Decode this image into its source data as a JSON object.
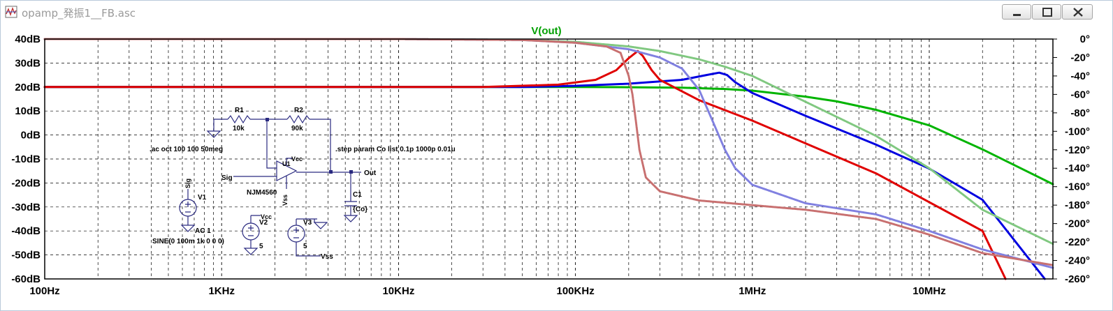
{
  "window": {
    "title": "opamp_発振1__FB.asc",
    "icon": "ltspice-waveform-icon",
    "buttons": [
      "minimize-icon",
      "maximize-icon",
      "close-icon"
    ]
  },
  "chart_data": {
    "type": "line",
    "title": "V(out)",
    "title_color": "#00a000",
    "x_scale": "log",
    "xlim": [
      100,
      50000000
    ],
    "x_ticks": [
      {
        "value": 100,
        "label": "100Hz"
      },
      {
        "value": 1000,
        "label": "1KHz"
      },
      {
        "value": 10000,
        "label": "10KHz"
      },
      {
        "value": 100000,
        "label": "100KHz"
      },
      {
        "value": 1000000,
        "label": "1MHz"
      },
      {
        "value": 10000000,
        "label": "10MHz"
      }
    ],
    "y_left": {
      "unit": "dB",
      "ylim": [
        -60,
        40
      ],
      "ticks": [
        {
          "value": 40,
          "label": "40dB"
        },
        {
          "value": 30,
          "label": "30dB"
        },
        {
          "value": 20,
          "label": "20dB"
        },
        {
          "value": 10,
          "label": "10dB"
        },
        {
          "value": 0,
          "label": "0dB"
        },
        {
          "value": -10,
          "label": "-10dB"
        },
        {
          "value": -20,
          "label": "-20dB"
        },
        {
          "value": -30,
          "label": "-30dB"
        },
        {
          "value": -40,
          "label": "-40dB"
        },
        {
          "value": -50,
          "label": "-50dB"
        },
        {
          "value": -60,
          "label": "-60dB"
        }
      ]
    },
    "y_right": {
      "unit": "°",
      "ylim": [
        -260,
        0
      ],
      "ticks": [
        {
          "value": 0,
          "label": "0°"
        },
        {
          "value": -20,
          "label": "-20°"
        },
        {
          "value": -40,
          "label": "-40°"
        },
        {
          "value": -60,
          "label": "-60°"
        },
        {
          "value": -80,
          "label": "-80°"
        },
        {
          "value": -100,
          "label": "-100°"
        },
        {
          "value": -120,
          "label": "-120°"
        },
        {
          "value": -140,
          "label": "-140°"
        },
        {
          "value": -160,
          "label": "-160°"
        },
        {
          "value": -180,
          "label": "-180°"
        },
        {
          "value": -200,
          "label": "-200°"
        },
        {
          "value": -220,
          "label": "-220°"
        },
        {
          "value": -240,
          "label": "-240°"
        },
        {
          "value": -260,
          "label": "-260°"
        }
      ]
    },
    "grid": true,
    "series": [
      {
        "color": "#00b400",
        "kind": "magnitude",
        "axis": "left",
        "points": [
          [
            100,
            20
          ],
          [
            100000,
            20
          ],
          [
            200000,
            19.9
          ],
          [
            400000,
            19.7
          ],
          [
            700000,
            19.2
          ],
          [
            1000000,
            18.5
          ],
          [
            2000000,
            16
          ],
          [
            3000000,
            14
          ],
          [
            5000000,
            10.5
          ],
          [
            10000000,
            4
          ],
          [
            20000000,
            -6
          ],
          [
            50000000,
            -20.5
          ]
        ]
      },
      {
        "color": "#0000e0",
        "kind": "magnitude",
        "axis": "left",
        "points": [
          [
            100,
            20
          ],
          [
            50000,
            20
          ],
          [
            100000,
            20.5
          ],
          [
            200000,
            21.4
          ],
          [
            400000,
            23
          ],
          [
            550000,
            25
          ],
          [
            650000,
            26
          ],
          [
            720000,
            25
          ],
          [
            800000,
            22
          ],
          [
            1000000,
            17.5
          ],
          [
            2000000,
            8
          ],
          [
            5000000,
            -4
          ],
          [
            10000000,
            -14
          ],
          [
            20000000,
            -27
          ],
          [
            45000000,
            -60
          ]
        ]
      },
      {
        "color": "#e00000",
        "kind": "magnitude",
        "axis": "left",
        "points": [
          [
            100,
            20
          ],
          [
            30000,
            20
          ],
          [
            80000,
            21
          ],
          [
            130000,
            23
          ],
          [
            170000,
            27
          ],
          [
            200000,
            32
          ],
          [
            225000,
            35
          ],
          [
            240000,
            33
          ],
          [
            270000,
            27
          ],
          [
            300000,
            23
          ],
          [
            500000,
            14.5
          ],
          [
            1000000,
            6
          ],
          [
            2000000,
            -3.5
          ],
          [
            5000000,
            -16
          ],
          [
            10000000,
            -28
          ],
          [
            20000000,
            -40
          ],
          [
            27000000,
            -60
          ]
        ]
      },
      {
        "color": "#80c880",
        "kind": "phase",
        "axis": "right",
        "dotted": true,
        "points": [
          [
            100,
            0
          ],
          [
            10000,
            0
          ],
          [
            50000,
            -1
          ],
          [
            100000,
            -3
          ],
          [
            200000,
            -8
          ],
          [
            300000,
            -13
          ],
          [
            500000,
            -22
          ],
          [
            700000,
            -30
          ],
          [
            1000000,
            -40
          ],
          [
            2000000,
            -68
          ],
          [
            5000000,
            -105
          ],
          [
            10000000,
            -140
          ],
          [
            20000000,
            -185
          ],
          [
            50000000,
            -222
          ]
        ]
      },
      {
        "color": "#8080e0",
        "kind": "phase",
        "axis": "right",
        "dotted": true,
        "points": [
          [
            100,
            0
          ],
          [
            10000,
            0
          ],
          [
            50000,
            -1
          ],
          [
            100000,
            -4
          ],
          [
            200000,
            -11
          ],
          [
            300000,
            -20
          ],
          [
            400000,
            -32
          ],
          [
            500000,
            -55
          ],
          [
            600000,
            -90
          ],
          [
            700000,
            -120
          ],
          [
            800000,
            -140
          ],
          [
            1000000,
            -158
          ],
          [
            2000000,
            -178
          ],
          [
            5000000,
            -190
          ],
          [
            10000000,
            -208
          ],
          [
            20000000,
            -228
          ],
          [
            50000000,
            -248
          ]
        ]
      },
      {
        "color": "#c87070",
        "kind": "phase",
        "axis": "right",
        "dotted": true,
        "points": [
          [
            100,
            0
          ],
          [
            10000,
            0
          ],
          [
            50000,
            -1
          ],
          [
            100000,
            -4
          ],
          [
            150000,
            -8
          ],
          [
            180000,
            -15
          ],
          [
            200000,
            -40
          ],
          [
            210000,
            -60
          ],
          [
            220000,
            -90
          ],
          [
            230000,
            -120
          ],
          [
            250000,
            -150
          ],
          [
            300000,
            -165
          ],
          [
            500000,
            -175
          ],
          [
            1000000,
            -180
          ],
          [
            2000000,
            -185
          ],
          [
            5000000,
            -195
          ],
          [
            10000000,
            -212
          ],
          [
            20000000,
            -232
          ],
          [
            50000000,
            -245
          ]
        ]
      }
    ]
  },
  "schematic": {
    "labels": {
      "r1": "R1",
      "r1_value": "10k",
      "r2": "R2",
      "r2_value": "90k",
      "u1": "U1",
      "u1_model": "NJM4560",
      "vcc": "Vcc",
      "vss": "Vss",
      "c1": "C1",
      "c1_value": "{Co}",
      "sig": "Sig",
      "out": "Out",
      "v1": "V1",
      "v1_ac": "AC 1",
      "v1_sine": "SINE(0 100m 1k 0 0 0)",
      "v2": "V2",
      "v2_value": "5",
      "v2_vcc": "Vcc",
      "v3": "V3",
      "v3_value": "5",
      "v3_vss": "Vss",
      "v1_sig": "Sig",
      "ac_directive": ".ac oct 100 100 50meg",
      "step_directive": ".step param Co list 0.1p 1000p 0.01u"
    }
  }
}
